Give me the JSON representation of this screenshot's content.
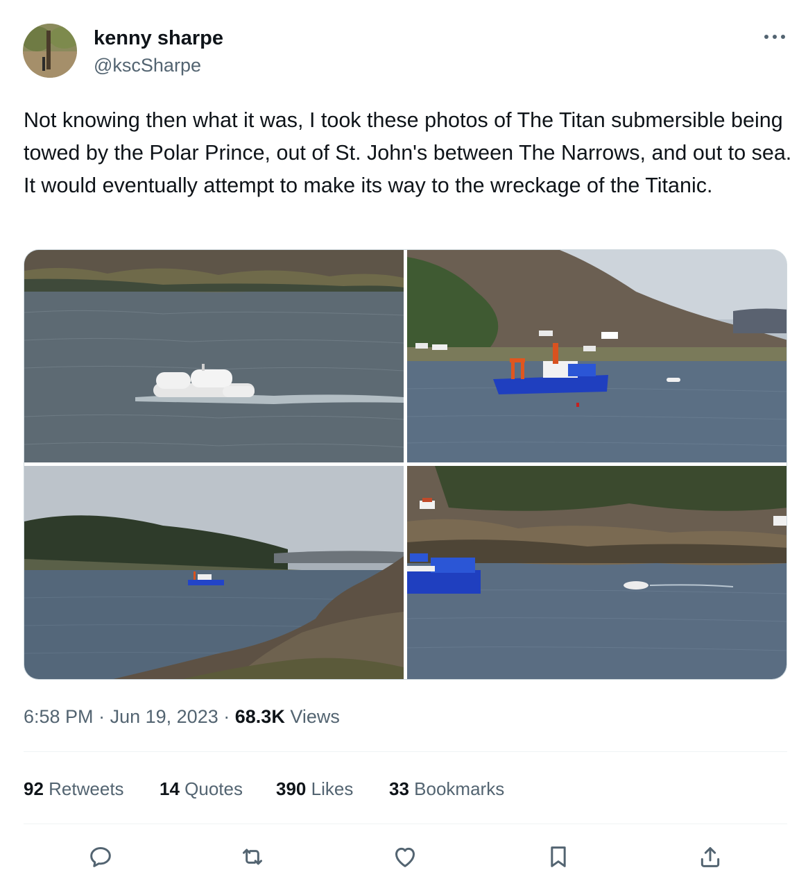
{
  "author": {
    "display_name": "kenny sharpe",
    "handle": "@kscSharpe"
  },
  "tweet": {
    "text": "Not knowing then what it was, I took these photos of The Titan submersible being towed by the Polar Prince, out of St. John's between The Narrows, and out to sea. It would eventually attempt to make its way to the wreckage of the Titanic.",
    "time": "6:58 PM",
    "separator": "·",
    "date": "Jun 19, 2023",
    "views_count": "68.3K",
    "views_label": "Views"
  },
  "stats": {
    "retweets": {
      "count": "92",
      "label": "Retweets"
    },
    "quotes": {
      "count": "14",
      "label": "Quotes"
    },
    "likes": {
      "count": "390",
      "label": "Likes"
    },
    "bookmarks": {
      "count": "33",
      "label": "Bookmarks"
    }
  },
  "icons": {
    "more": "more-dots-icon",
    "reply": "reply-icon",
    "retweet": "retweet-icon",
    "like": "heart-icon",
    "bookmark": "bookmark-icon",
    "share": "share-icon"
  },
  "colors": {
    "text_primary": "#0f1419",
    "text_secondary": "#536471",
    "divider": "#eff3f4"
  }
}
